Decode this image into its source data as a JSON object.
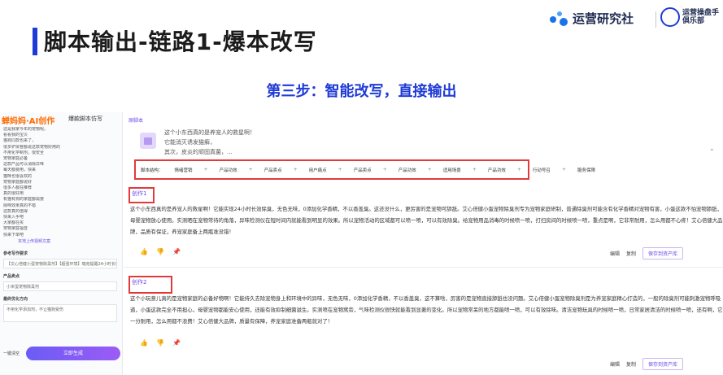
{
  "slide": {
    "title": "脚本输出-链路1-爆本改写",
    "step": "第三步：智能改写，直接输出",
    "logo_primary": "运营研究社",
    "logo_secondary_lines": [
      "运营操盘手",
      "俱乐部"
    ]
  },
  "left_panel": {
    "brand": "蝉妈妈·AI创作",
    "tool_name": "爆款脚本仿写",
    "script_lines": [
      "这是我家今年的宠物呢。",
      "看看我的宝贝",
      "猫狗同款也来了，",
      "很多铲屎官都说这款宠物好用的",
      "不用化学制剂，很安全",
      "宠物家庭必备",
      "这款产品可以消除异味",
      "每天都要用，快来",
      "猫咪也很喜欢的",
      "宠物家庭都说好",
      "很多人都在推荐",
      "真的很好用",
      "有猫有狗的家庭都需要",
      "除味效果真的不错",
      "这款真的值得",
      "快来入手吧",
      "大家都在买",
      "宠物家庭福音",
      "快来下单吧"
    ],
    "section_label": "本地上传视频文案",
    "input1_label": "参考写作要求",
    "input1_value": "【文心倍健小蛋宠物除臭剂】【超强环境】瑞克提醒24小时长效除臭",
    "input2_label": "产品卖点",
    "input2_value": "小米蛋宠物除臭剂",
    "input3_label": "最终优化方向",
    "input3_value": "不用化学添加剂，不让猫狗受伤",
    "cancel_label": "一键清空",
    "generate_label": "立即生成"
  },
  "main": {
    "original_tag": "原脚本",
    "original_lines": [
      "这个小东西真的是养宠人的救星啊！",
      "它能消灭诱发猫癣，",
      "其次，皮炎的顽固真菌，..."
    ],
    "structure_label": "脚本结构：",
    "structure_items": [
      "情绪营销",
      "产品功效",
      "产品卖点",
      "用户痛点",
      "产品卖点",
      "产品功效",
      "适用场景",
      "产品功效",
      "行动号召",
      "服务保障"
    ],
    "creations": [
      {
        "tag": "创作1",
        "text": "这个小东西真的是养宠人的救星啊！它能实现24小时长效除臭，无色无味，0添加化学香精，不以香盖臭。这还没什么，更厉害的是宠物可舔舐。艾心倍健小蛋宠物除臭剂专为宠物家庭研制，普通除臭剂可能含有化学香精对宠物有害，小蛋这款不怕宠物舔舐，母婴宠物放心使用。实测晒在宠物常待的角落，异味检测仪在短时间内就能看到明显的效果。所以宠物活动的区域都可以喷一喷，可以有效除臭。给宠物用品消毒的时候喷一喷，打扫房间的时候喷一喷，重点是啊，它非常耐用，怎么用都不心疼！艾心倍健大品牌，品质有保证，养宠家庭备上两瓶准没错！"
      },
      {
        "tag": "创作2",
        "text": "这个小玩意儿真的是宠物家庭的必备好物啊！它能持久去除宠物身上和环境中的异味，无色无味，0添加化学香精，不以香盖臭，这不算啥，厉害的是宠物直接舔舐也没问题。艾心倍健小蛋宠物除臭剂是为养宠家庭精心打造的，一般的除臭剂可能刺激宠物呼吸道，小蛋这款完全不用担心，母婴宠物都能安心使用，还能有效抑制细菌滋生。实测喷在宠物窝旁，气味检测仪很快就能看到显著的变化。所以宠物常呆的地方都能喷一喷，可以有效除味。清洁宠物玩具的时候喷一喷，日常家居清洁的时候喷一喷，还有啊，它一分耐用，怎么用都不浪费！艾心倍健大品牌，质量有保障，养宠家庭准备两瓶就对了！"
      }
    ],
    "actions": {
      "edit": "编辑",
      "copy": "复制",
      "save": "保存到资产库"
    }
  },
  "colors": {
    "accent": "#1f3bd6",
    "highlight": "#e23a3a",
    "purple": "#6b4ae8"
  }
}
